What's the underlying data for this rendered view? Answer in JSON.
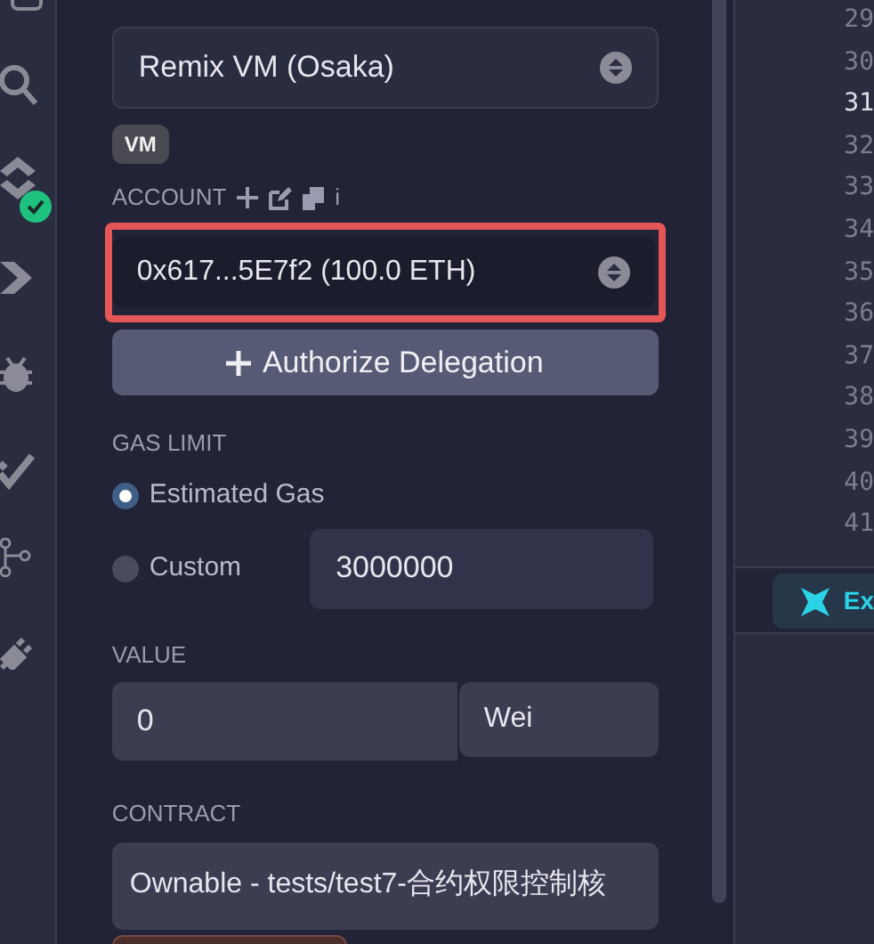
{
  "panel": {
    "environment": "Remix VM (Osaka)",
    "env_badge": "VM",
    "account_label": "ACCOUNT",
    "account_info": "i",
    "account": "0x617...5E7f2 (100.0 ETH)",
    "authorize_button": "Authorize Delegation",
    "gas_label": "GAS LIMIT",
    "gas_options": [
      {
        "label": "Estimated Gas",
        "selected": true
      },
      {
        "label": "Custom",
        "selected": false
      }
    ],
    "gas_value": "3000000",
    "value_label": "VALUE",
    "value": "0",
    "unit": "Wei",
    "contract_label": "CONTRACT",
    "contract": "Ownable - tests/test7-合约权限控制核"
  },
  "sidebar": {
    "deploy_checked": true
  },
  "editor": {
    "line_numbers": [
      {
        "text": "29",
        "selected": false
      },
      {
        "text": "30",
        "selected": false
      },
      {
        "text": "31",
        "selected": true
      },
      {
        "text": "32",
        "selected": false
      },
      {
        "text": "33",
        "selected": false
      },
      {
        "text": "34",
        "selected": false
      },
      {
        "text": "35",
        "selected": false
      },
      {
        "text": "36",
        "selected": false
      },
      {
        "text": "37",
        "selected": false
      },
      {
        "text": "38",
        "selected": false
      },
      {
        "text": "39",
        "selected": false
      },
      {
        "text": "40",
        "selected": false
      },
      {
        "text": "41",
        "selected": false
      }
    ],
    "tab": "Ex"
  }
}
